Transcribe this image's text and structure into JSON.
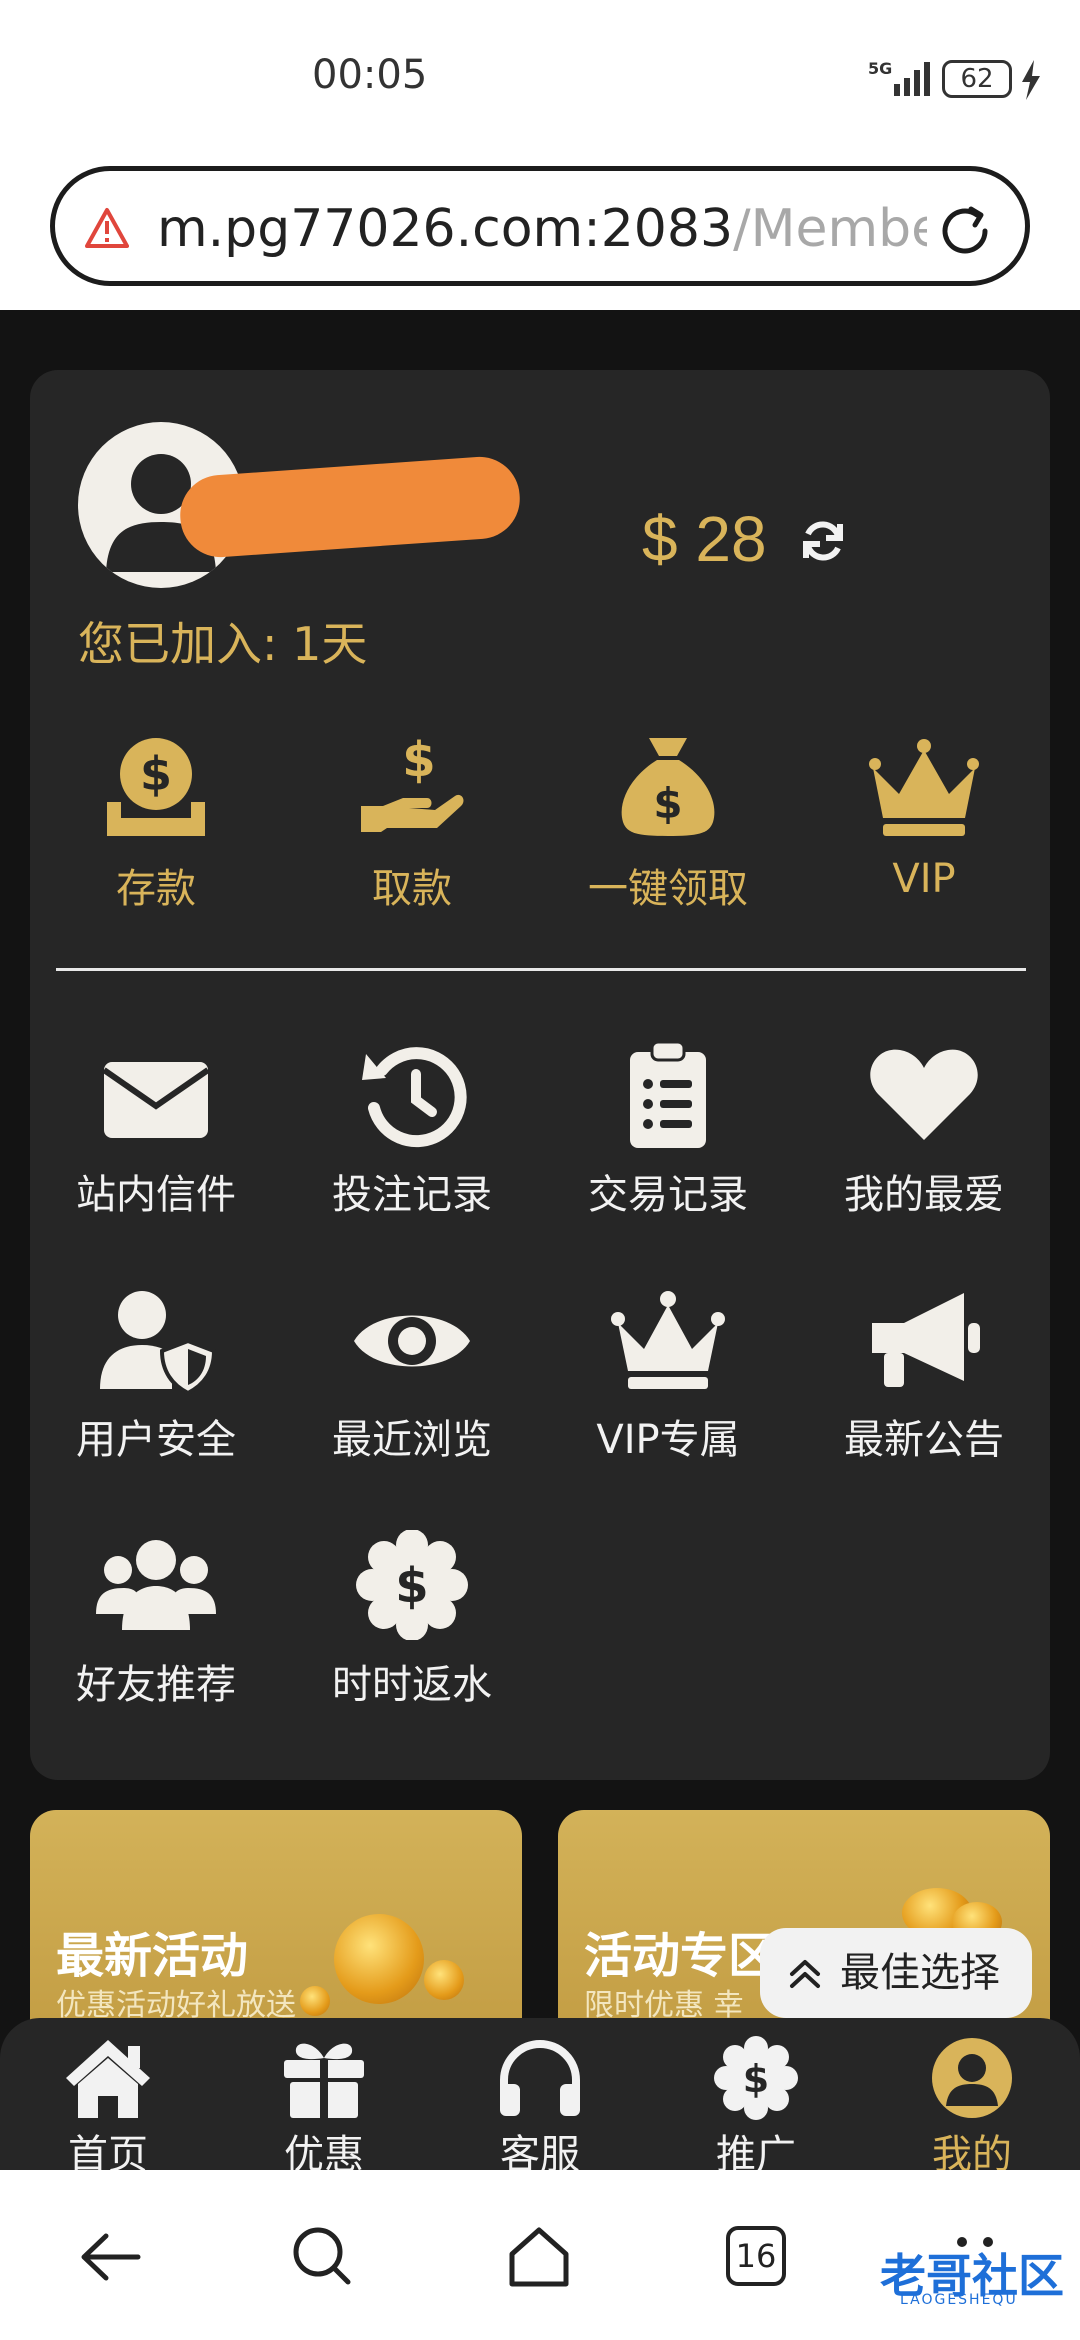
{
  "status_bar": {
    "time": "00:05",
    "network": "5G",
    "battery": "62"
  },
  "browser": {
    "url_main": "m.pg77026.com:2083",
    "url_rest": "/Membe"
  },
  "account": {
    "balance": "$ 28",
    "joined": "您已加入: 1天"
  },
  "quick_actions": [
    {
      "label": "存款",
      "icon": "coin-deposit-icon"
    },
    {
      "label": "取款",
      "icon": "hand-withdraw-icon"
    },
    {
      "label": "一键领取",
      "icon": "money-bag-icon"
    },
    {
      "label": "VIP",
      "icon": "crown-icon"
    }
  ],
  "menu": [
    {
      "label": "站内信件",
      "icon": "envelope-icon"
    },
    {
      "label": "投注记录",
      "icon": "history-icon"
    },
    {
      "label": "交易记录",
      "icon": "clipboard-list-icon"
    },
    {
      "label": "我的最爱",
      "icon": "heart-icon"
    },
    {
      "label": "用户安全",
      "icon": "user-shield-icon"
    },
    {
      "label": "最近浏览",
      "icon": "eye-icon"
    },
    {
      "label": "VIP专属",
      "icon": "crown-icon"
    },
    {
      "label": "最新公告",
      "icon": "megaphone-icon"
    },
    {
      "label": "好友推荐",
      "icon": "users-icon"
    },
    {
      "label": "时时返水",
      "icon": "dollar-badge-icon"
    }
  ],
  "promos": [
    {
      "title": "最新活动",
      "subtitle": "优惠活动好礼放送"
    },
    {
      "title": "活动专区",
      "subtitle": "限时优惠 幸"
    }
  ],
  "best_choice": "最佳选择",
  "bottom_nav": [
    {
      "label": "首页",
      "icon": "home-icon"
    },
    {
      "label": "优惠",
      "icon": "gift-icon"
    },
    {
      "label": "客服",
      "icon": "headset-icon"
    },
    {
      "label": "推广",
      "icon": "dollar-badge-icon"
    },
    {
      "label": "我的",
      "icon": "user-icon",
      "active": true
    }
  ],
  "system_nav": {
    "tab_count": "16"
  },
  "watermark": {
    "title": "老哥社区",
    "subtitle": "LAOGESHEQU"
  },
  "colors": {
    "gold": "#d9b45a",
    "card": "#262626",
    "background": "#131313",
    "accent_orange": "#f08a3a"
  }
}
